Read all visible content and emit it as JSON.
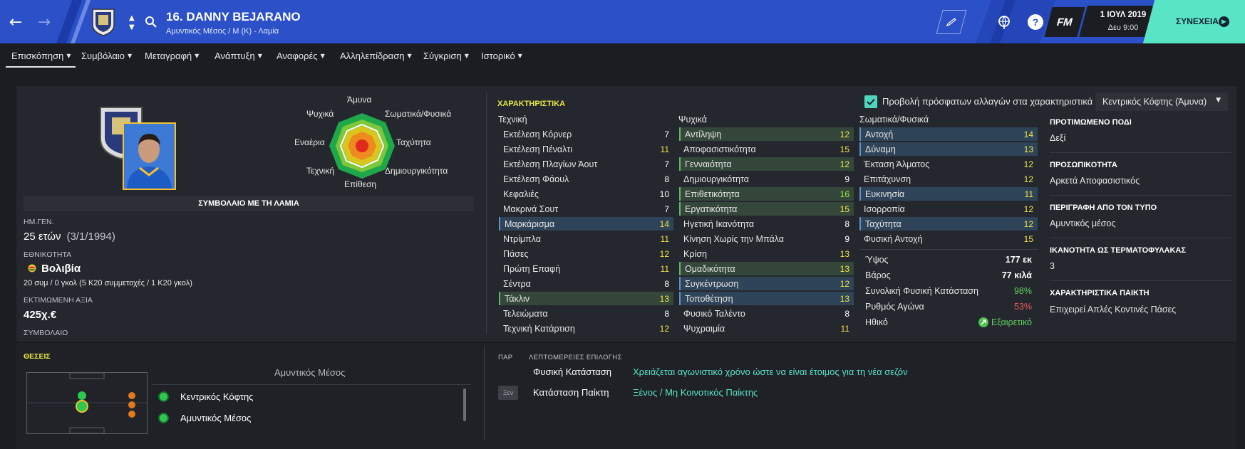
{
  "header": {
    "player_title": "16. DANNY BEJARANO",
    "player_subtitle": "Αμυντικός Μέσος / Μ (Κ) - Λαμία",
    "date": "1 ΙΟΥΛ 2019",
    "day_time": "Δευ 9:00",
    "continue_label": "ΣΥΝΕΧΕΙΑ",
    "fm_logo": "FM",
    "help_glyph": "?"
  },
  "tabs": [
    {
      "label": "Επισκόπηση"
    },
    {
      "label": "Συμβόλαιο"
    },
    {
      "label": "Μεταγραφή"
    },
    {
      "label": "Ανάπτυξη"
    },
    {
      "label": "Αναφορές"
    },
    {
      "label": "Αλληλεπίδραση"
    },
    {
      "label": "Σύγκριση"
    },
    {
      "label": "Ιστορικό"
    }
  ],
  "radar": {
    "top": "Άμυνα",
    "top_right": "Σωματικά/Φυσικά",
    "right": "Ταχύτητα",
    "bottom_right": "Δημιουργικότητα",
    "bottom": "Επίθεση",
    "bottom_left": "Τεχνική",
    "left": "Εναέρια",
    "top_left": "Ψυχικά"
  },
  "profile": {
    "contract_banner": "ΣΥΜΒΟΛΑΙΟ ΜΕ ΤΗ ΛΑΜΙΑ",
    "dob_label": "ΗΜ.ΓΕΝ.",
    "age": "25 ετών",
    "dob": "(3/1/1994)",
    "nationality_label": "ΕΘΝΙΚΟΤΗΤΑ",
    "nationality": "Βολιβία",
    "caps": "20 συμ / 0 γκολ (5 Κ20 συμμετοχές / 1 Κ20 γκολ)",
    "value_label": "ΕΚΤΙΜΩΜΕΝΗ ΑΞΙΑ",
    "value": "425χ.€",
    "contract_label": "ΣΥΜΒΟΛΑΙΟ"
  },
  "attributes": {
    "title": "ΧΑΡΑΚΤΗΡΙΣΤΙΚΑ",
    "recent_changes_label": "Προβολή πρόσφατων αλλαγών στα χαρακτηριστικά",
    "role_select": "Κεντρικός Κόφτης (Άμυνα)",
    "technical_head": "Τεχνική",
    "mental_head": "Ψυχικά",
    "physical_head": "Σωματικά/Φυσικά",
    "technical": [
      {
        "name": "Εκτέλεση Κόρνερ",
        "value": "7"
      },
      {
        "name": "Εκτέλεση Πέναλτι",
        "value": "11"
      },
      {
        "name": "Εκτέλεση Πλαγίων Άουτ",
        "value": "7"
      },
      {
        "name": "Εκτέλεση Φάουλ",
        "value": "8"
      },
      {
        "name": "Κεφαλιές",
        "value": "10"
      },
      {
        "name": "Μακρινά Σουτ",
        "value": "7"
      },
      {
        "name": "Μαρκάρισμα",
        "value": "14"
      },
      {
        "name": "Ντρίμπλα",
        "value": "11"
      },
      {
        "name": "Πάσες",
        "value": "12"
      },
      {
        "name": "Πρώτη Επαφή",
        "value": "11"
      },
      {
        "name": "Σέντρα",
        "value": "8"
      },
      {
        "name": "Τάκλιν",
        "value": "13"
      },
      {
        "name": "Τελειώματα",
        "value": "8"
      },
      {
        "name": "Τεχνική Κατάρτιση",
        "value": "12"
      }
    ],
    "mental": [
      {
        "name": "Αντίληψη",
        "value": "12"
      },
      {
        "name": "Αποφασιστικότητα",
        "value": "15"
      },
      {
        "name": "Γενναιότητα",
        "value": "12"
      },
      {
        "name": "Δημιουργικότητα",
        "value": "9"
      },
      {
        "name": "Επιθετικότητα",
        "value": "16"
      },
      {
        "name": "Εργατικότητα",
        "value": "15"
      },
      {
        "name": "Ηγετική Ικανότητα",
        "value": "8"
      },
      {
        "name": "Κίνηση Χωρίς την Μπάλα",
        "value": "9"
      },
      {
        "name": "Κρίση",
        "value": "13"
      },
      {
        "name": "Ομαδικότητα",
        "value": "13"
      },
      {
        "name": "Συγκέντρωση",
        "value": "12"
      },
      {
        "name": "Τοποθέτηση",
        "value": "13"
      },
      {
        "name": "Φυσικό Ταλέντο",
        "value": "8"
      },
      {
        "name": "Ψυχραιμία",
        "value": "11"
      }
    ],
    "physical": [
      {
        "name": "Αντοχή",
        "value": "14"
      },
      {
        "name": "Δύναμη",
        "value": "13"
      },
      {
        "name": "Έκταση Άλματος",
        "value": "12"
      },
      {
        "name": "Επιτάχυνση",
        "value": "12"
      },
      {
        "name": "Ευκινησία",
        "value": "11"
      },
      {
        "name": "Ισορροπία",
        "value": "12"
      },
      {
        "name": "Ταχύτητα",
        "value": "12"
      },
      {
        "name": "Φυσική Αντοχή",
        "value": "15"
      }
    ]
  },
  "physical_info": {
    "height_label": "Ύψος",
    "height": "177 εκ",
    "weight_label": "Βάρος",
    "weight": "77 κιλά",
    "condition_label": "Συνολική Φυσική Κατάσταση",
    "condition": "98%",
    "sharpness_label": "Ρυθμός Αγώνα",
    "sharpness": "53%",
    "morale_label": "Ηθικό",
    "morale": "Εξαιρετικό"
  },
  "side": {
    "foot_label": "ΠΡΟΤΙΜΩΜΕΝΟ ΠΟΔΙ",
    "foot": "Δεξί",
    "personality_label": "ΠΡΟΣΩΠΙΚΟΤΗΤΑ",
    "personality": "Αρκετά Αποφασιστικός",
    "media_label": "ΠΕΡΙΓΡΑΦΗ ΑΠΟ ΤΟΝ ΤΥΠΟ",
    "media": "Αμυντικός μέσος",
    "gk_label": "ΙΚΑΝΟΤΗΤΑ ΩΣ ΤΕΡΜΑΤΟΦΥΛΑΚΑΣ",
    "gk": "3",
    "traits_label": "ΧΑΡΑΚΤΗΡΙΣΤΙΚΑ ΠΑΙΚΤΗ",
    "traits": "Επιχειρεί Απλές Κοντινές Πάσες"
  },
  "positions": {
    "title": "ΘΕΣΕΙΣ",
    "role_head": "Αμυντικός Μέσος",
    "items": [
      {
        "label": "Κεντρικός Κόφτης"
      },
      {
        "label": "Αμυντικός Μέσος"
      }
    ]
  },
  "selection": {
    "col1": "ΠΑΡ",
    "col2": "ΛΕΠΤΟΜΕΡΕΙΕΣ ΕΠΙΛΟΓΗΣ",
    "fitness_label": "Φυσική Κατάσταση",
    "fitness_value": "Χρειάζεται αγωνιστικό χρόνο ώστε να είναι έτοιμος για τη νέα σεζόν",
    "status_badge": "Ξεν",
    "status_label": "Κατάσταση Παίκτη",
    "status_value": "Ξένος / Μη Κοινοτικός Παίκτης"
  },
  "colors": {
    "header_blue": "#2b50c8",
    "accent_teal": "#59e4c6",
    "section_yellow": "#e8e846",
    "good_green": "#5fd05f",
    "bad_red": "#e85a5a"
  }
}
